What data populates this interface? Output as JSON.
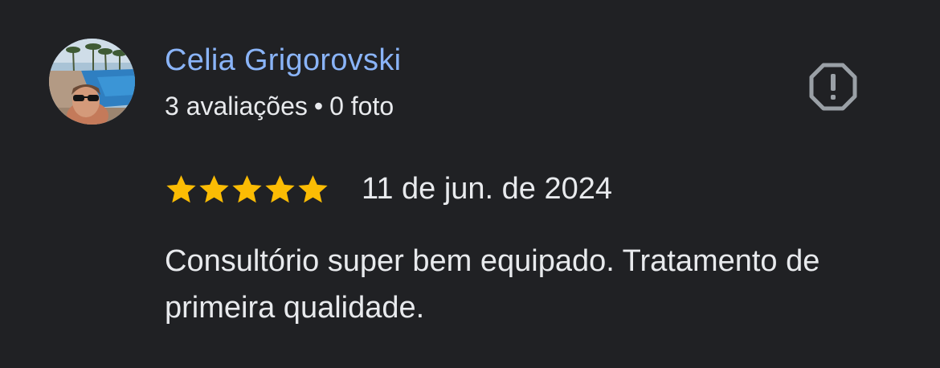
{
  "review": {
    "author_name": "Celia Grigorovski",
    "reviews_count": "3 avaliações",
    "separator": "•",
    "photos_count": "0 foto",
    "rating": 5,
    "rating_max": 5,
    "date": "11 de jun. de 2024",
    "text": "Consultório super bem equipado. Tratamento de primeira qualidade."
  },
  "icons": {
    "report": "report-octagon-icon",
    "star": "star-icon"
  },
  "colors": {
    "background": "#202124",
    "author_name": "#8ab4f8",
    "text": "#e8eaed",
    "star": "#fbbc04",
    "report_icon": "#9aa0a6"
  }
}
